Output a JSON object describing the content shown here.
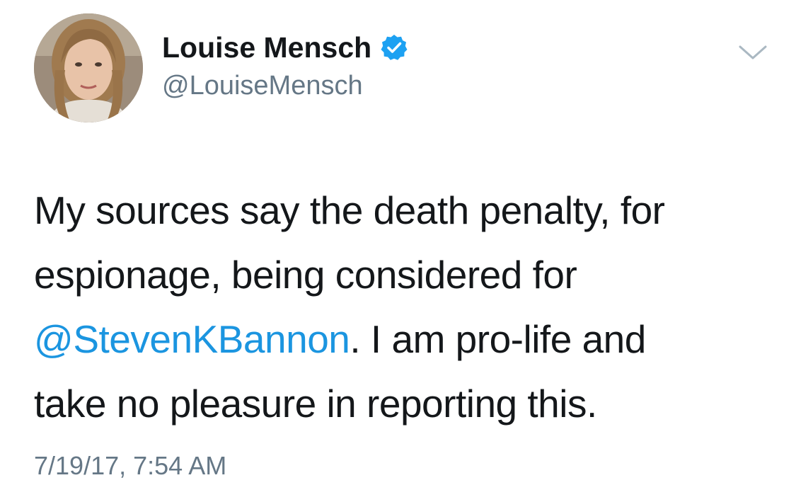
{
  "tweet": {
    "author": {
      "display_name": "Louise Mensch",
      "handle": "@LouiseMensch",
      "verified": true,
      "avatar_icon": "profile-photo"
    },
    "text": {
      "line1": "My sources say the death penalty, for",
      "line2": "espionage, being considered for",
      "mention": "@StevenKBannon",
      "line3_rest": ". I am pro-life and",
      "line4": "take no pleasure in reporting this."
    },
    "timestamp": "7/19/17, 7:54 AM",
    "menu_icon": "chevron-down-icon"
  },
  "colors": {
    "text": "#14171a",
    "secondary": "#657786",
    "link": "#1b95e0",
    "verified_badge": "#1da1f2",
    "caret": "#aab8c2"
  }
}
